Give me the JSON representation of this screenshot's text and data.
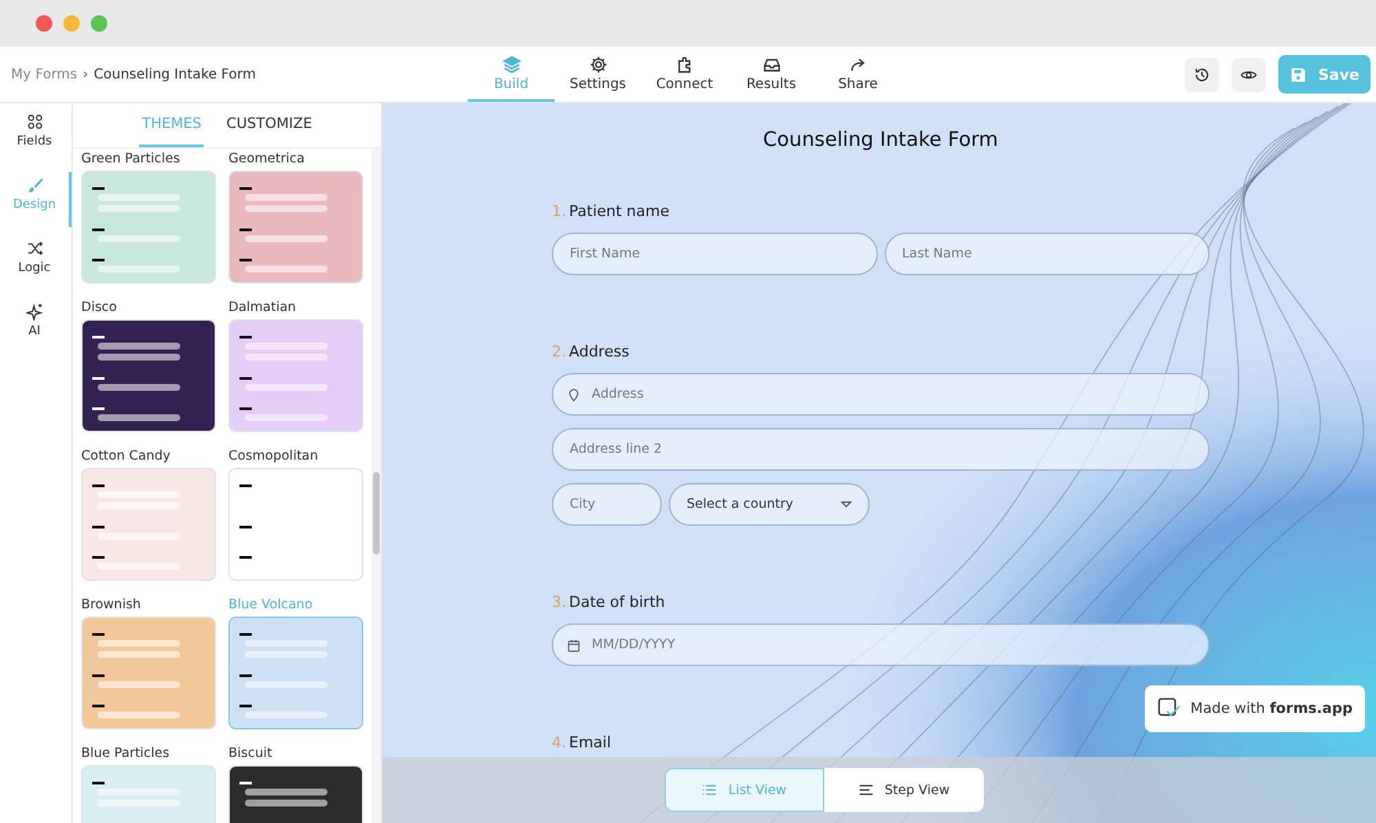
{
  "breadcrumb": {
    "parent": "My Forms",
    "separator": "›",
    "current": "Counseling Intake Form"
  },
  "nav_tabs": [
    {
      "label": "Build",
      "selected": true
    },
    {
      "label": "Settings",
      "selected": false
    },
    {
      "label": "Connect",
      "selected": false
    },
    {
      "label": "Results",
      "selected": false
    },
    {
      "label": "Share",
      "selected": false
    }
  ],
  "save_button": {
    "label": "Save"
  },
  "rail": [
    {
      "label": "Fields",
      "selected": false
    },
    {
      "label": "Design",
      "selected": true
    },
    {
      "label": "Logic",
      "selected": false
    },
    {
      "label": "AI",
      "selected": false
    }
  ],
  "panel_tabs": [
    {
      "label": "THEMES",
      "selected": true
    },
    {
      "label": "CUSTOMIZE",
      "selected": false
    }
  ],
  "themes": [
    {
      "name": "Green Particles",
      "color": "#c8e8de",
      "selected": false
    },
    {
      "name": "Geometrica",
      "color": "#e9b9be",
      "selected": false
    },
    {
      "name": "Disco",
      "color": "#33214f",
      "selected": false
    },
    {
      "name": "Dalmatian",
      "color": "#e4cdf7",
      "selected": false
    },
    {
      "name": "Cotton Candy",
      "color": "#fbe6e7",
      "selected": false
    },
    {
      "name": "Cosmopolitan",
      "color": "#ffffff",
      "selected": false
    },
    {
      "name": "Brownish",
      "color": "#f2c79a",
      "selected": false
    },
    {
      "name": "Blue Volcano",
      "color": "#cde0f6",
      "selected": true
    },
    {
      "name": "Blue Particles",
      "color": "#d7eef2",
      "selected": false
    },
    {
      "name": "Biscuit",
      "color": "#2c2c2c",
      "selected": false
    }
  ],
  "form": {
    "title": "Counseling Intake Form",
    "questions": [
      {
        "number": "1.",
        "label": "Patient name",
        "rows": [
          [
            {
              "placeholder": "First Name",
              "kind": "text"
            },
            {
              "placeholder": "Last Name",
              "kind": "text"
            }
          ]
        ]
      },
      {
        "number": "2.",
        "label": "Address",
        "rows": [
          [
            {
              "placeholder": "Address",
              "kind": "location"
            }
          ],
          [
            {
              "placeholder": "Address line 2",
              "kind": "text"
            }
          ],
          [
            {
              "placeholder": "City",
              "kind": "short"
            },
            {
              "placeholder": "Select a country",
              "kind": "select"
            }
          ]
        ]
      },
      {
        "number": "3.",
        "label": "Date of birth",
        "rows": [
          [
            {
              "placeholder": "MM/DD/YYYY",
              "kind": "date"
            }
          ]
        ]
      },
      {
        "number": "4.",
        "label": "Email"
      }
    ]
  },
  "badge": {
    "text": "Made with **forms.app**"
  },
  "view_toggle": [
    {
      "label": "List View",
      "selected": true
    },
    {
      "label": "Step View",
      "selected": false
    }
  ]
}
